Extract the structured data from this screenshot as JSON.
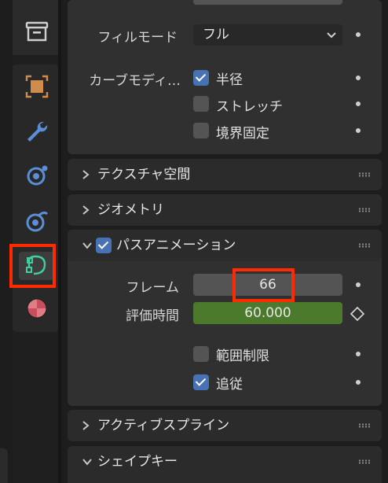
{
  "tabs": {
    "items": [
      {
        "icon": "archive-icon"
      },
      {
        "icon": "object-icon"
      },
      {
        "icon": "wrench-modifier-icon"
      },
      {
        "icon": "particles-icon"
      },
      {
        "icon": "physics-icon"
      },
      {
        "icon": "curve-data-icon",
        "active": true
      },
      {
        "icon": "material-icon"
      }
    ]
  },
  "shape": {
    "fill_mode_label": "フィルモード",
    "fill_mode_value": "フル",
    "curve_deform_label": "カーブモディ…",
    "radius_label": "半径",
    "radius_checked": true,
    "stretch_label": "ストレッチ",
    "stretch_checked": false,
    "bounds_clamp_label": "境界固定",
    "bounds_clamp_checked": false
  },
  "panels": {
    "texture_space": "テクスチャ空間",
    "geometry": "ジオメトリ",
    "path_animation": "パスアニメーション",
    "active_spline": "アクティブスプライン",
    "shape_keys": "シェイプキー"
  },
  "path_animation": {
    "enabled": true,
    "frames_label": "フレーム",
    "frames_value": "66",
    "eval_time_label": "評価時間",
    "eval_time_value": "60.000",
    "clamp_label": "範囲制限",
    "clamp_checked": false,
    "follow_label": "追従",
    "follow_checked": true
  },
  "colors": {
    "accent": "#4772b3",
    "keyframed_field": "#4b7a2c",
    "highlight": "#ff2a00"
  }
}
